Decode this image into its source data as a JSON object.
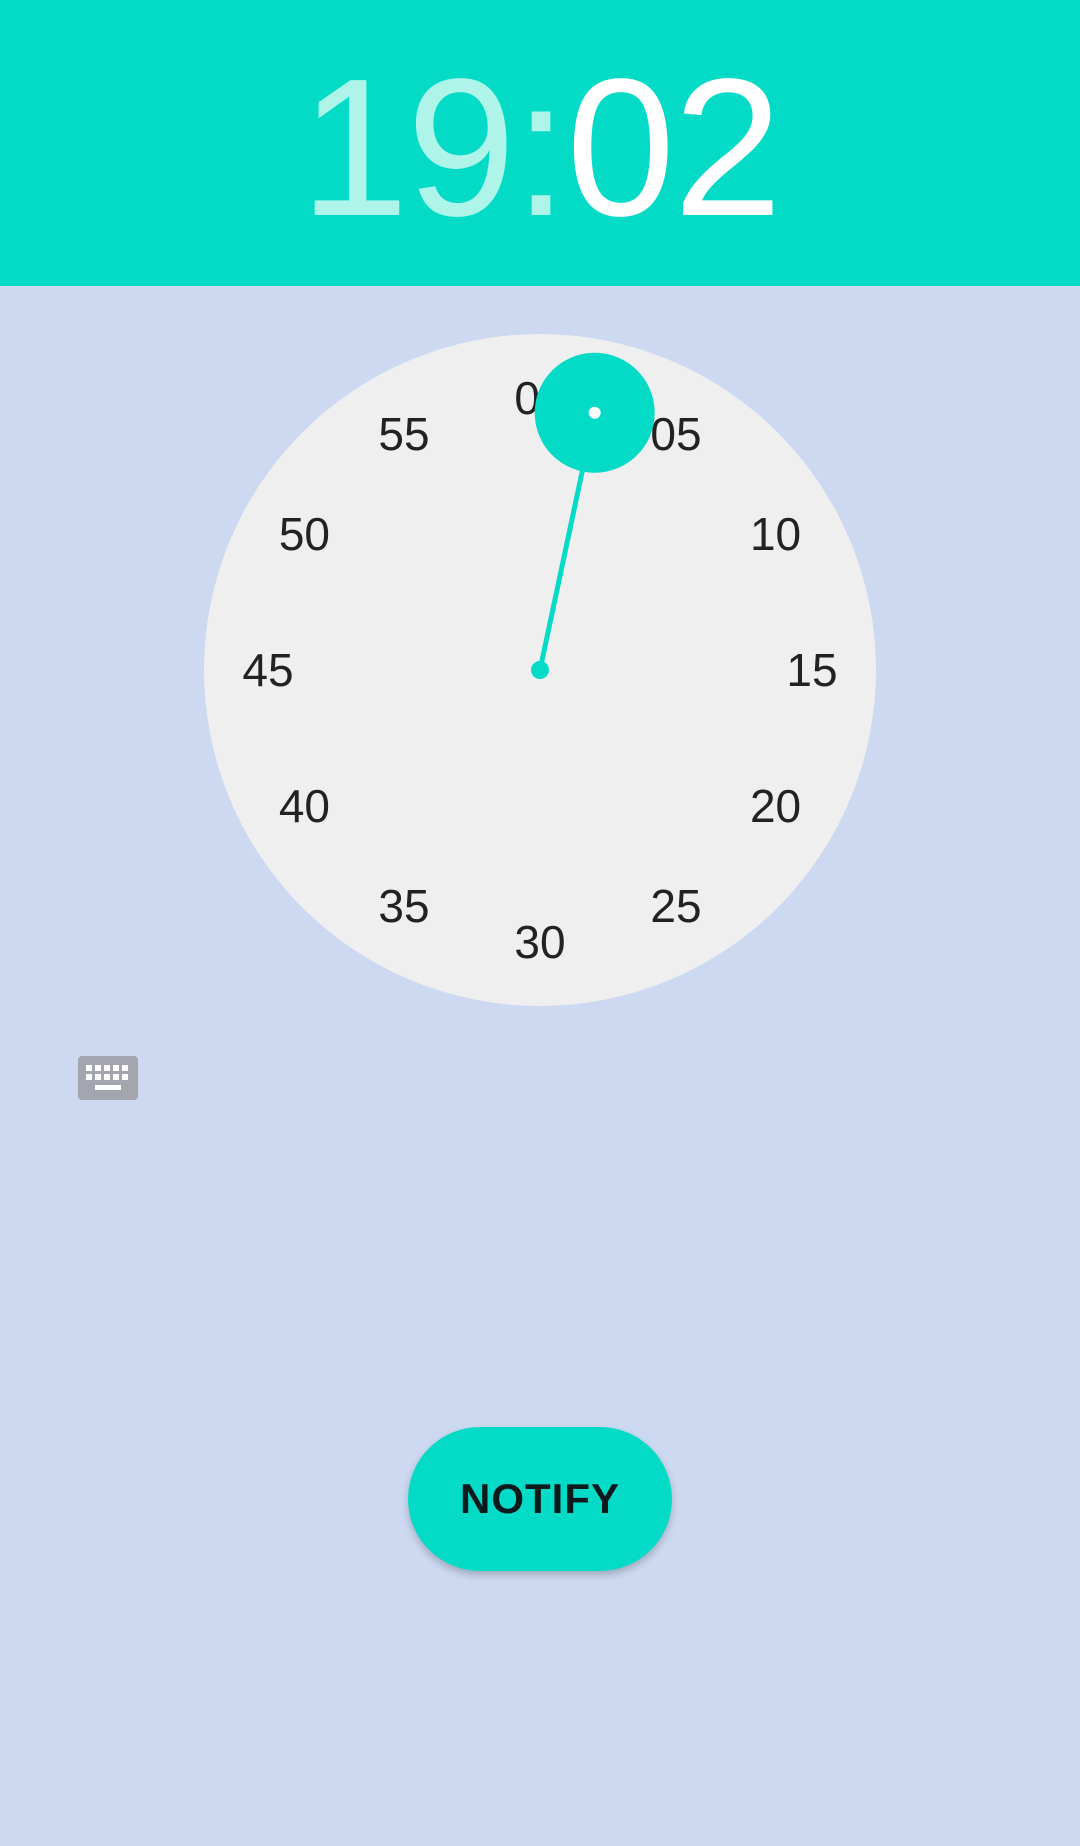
{
  "time": {
    "hours": "19",
    "separator": ":",
    "minutes": "02"
  },
  "dial": {
    "mode": "minutes",
    "selected_value": 2,
    "labels": [
      "00",
      "05",
      "10",
      "15",
      "20",
      "25",
      "30",
      "35",
      "40",
      "45",
      "50",
      "55"
    ]
  },
  "keyboard_toggle": {
    "icon": "keyboard-icon"
  },
  "notify_button": {
    "label": "NOTIFY"
  },
  "colors": {
    "accent": "#04dbc7",
    "background": "#ccd9f1",
    "dial_face": "#efefef",
    "inactive_header_text": "#aef4e9",
    "active_header_text": "#ffffff",
    "dial_text": "#222222",
    "icon_gray": "#a3a6ae"
  }
}
